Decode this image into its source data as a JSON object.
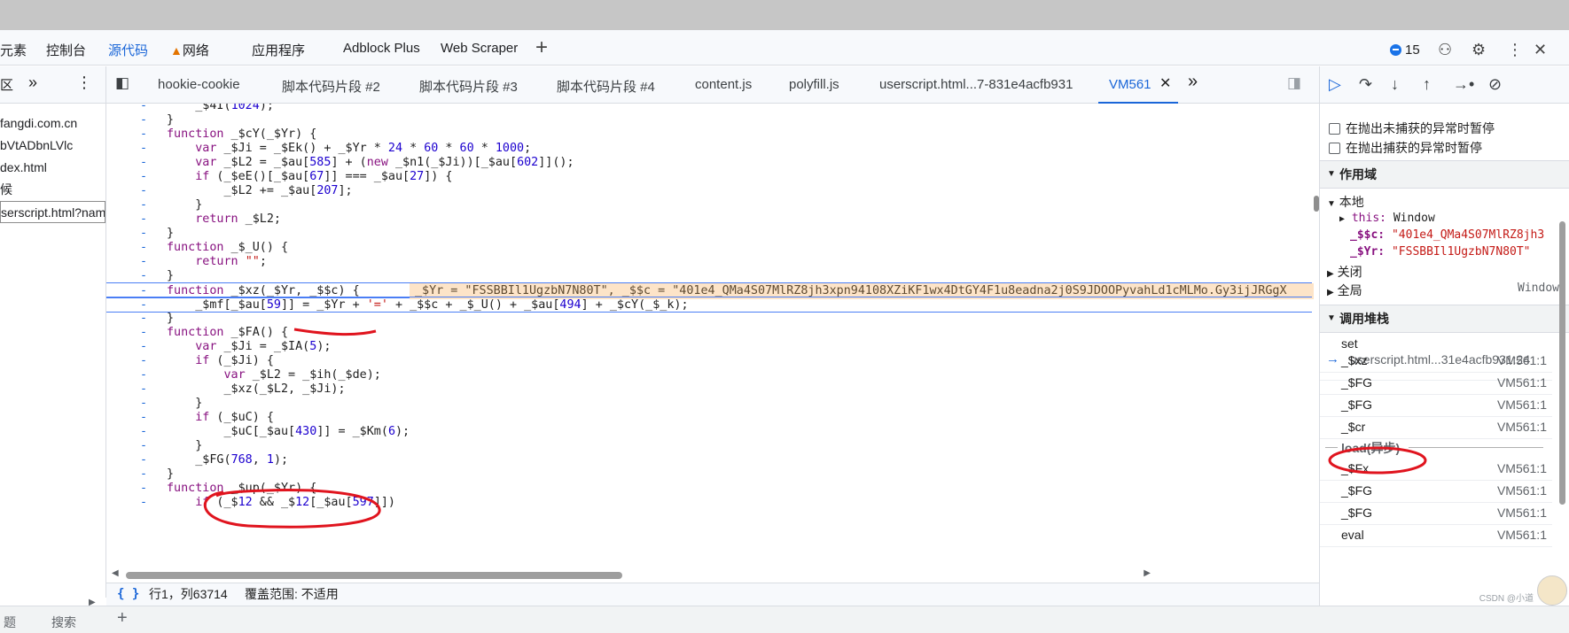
{
  "main_tabs": [
    "元素",
    "控制台",
    "源代码",
    "网络",
    "应用程序",
    "Adblock Plus",
    "Web Scraper"
  ],
  "active_main_tab": "源代码",
  "issues_count": "15",
  "navigator": {
    "items": [
      "fangdi.com.cn",
      "bVtADbnLVlc",
      "dex.html",
      "候",
      "serscript.html?name"
    ]
  },
  "source_tabs": [
    "hookie-cookie",
    "脚本代码片段 #2",
    "脚本代码片段 #3",
    "脚本代码片段 #4",
    "content.js",
    "polyfill.js",
    "userscript.html...7-831e4acfb931",
    "VM561"
  ],
  "active_source_tab": "VM561",
  "code_lines": [
    "    _$4I(1024);",
    "}",
    "function _$cY(_$Yr) {",
    "    var _$Ji = _$Ek() + _$Yr * 24 * 60 * 60 * 1000;",
    "    var _$L2 = _$au[585] + (new _$n1(_$Ji))[_$au[602]]();",
    "    if (_$eE()[_$au[67]] === _$au[27]) {",
    "        _$L2 += _$au[207];",
    "    }",
    "    return _$L2;",
    "}",
    "function _$_U() {",
    "    return \"\";",
    "}",
    "function _$xz(_$Yr, _$$c) {",
    "    _$mf[_$au[59]] = _$Yr + '=' + _$$c + _$_U() + _$au[494] + _$cY(_$_k);",
    "}",
    "function _$FA() {",
    "    var _$Ji = _$IA(5);",
    "    if (_$Ji) {",
    "        var _$L2 = _$ih(_$de);",
    "        _$xz(_$L2, _$Ji);",
    "    }",
    "    if (_$uC) {",
    "        _$uC[_$au[430]] = _$Km(6);",
    "    }",
    "    _$FG(768, 1);",
    "}",
    "function _$up(_$Yr) {",
    "    if (_$12 && _$12[_$au[597]])"
  ],
  "gutter_marker": "-",
  "inline_values": "_$Yr = \"FSSBBIl1UgzbN7N80T\", _$$c = \"401e4_QMa4S07MlRZ8jh3xpn94108XZiKF1wx4DtGY4F1u8eadna2j0S9JDOOPyvahLd1cMLMo.Gy3ijJRGgX",
  "status": {
    "position": "行1，列63714",
    "coverage": "覆盖范围: 不适用"
  },
  "drawer_tabs": [
    "题",
    "搜索",
    "+"
  ],
  "debugger": {
    "pause_uncaught": "在抛出未捕获的异常时暂停",
    "pause_caught": "在抛出捕获的异常时暂停",
    "scope_header": "作用域",
    "local_label": "本地",
    "this_key": "this:",
    "this_val": "Window",
    "var1_key": "_$$c:",
    "var1_val": "\"401e4_QMa4S07MlRZ8jh3",
    "var2_key": "_$Yr:",
    "var2_val": "\"FSSBBIl1UgzbN7N80T\"",
    "closure_label": "关闭",
    "global_label": "全局",
    "global_val": "Window",
    "callstack_header": "调用堆栈",
    "set_label": "set",
    "set_loc": "userscript.html...31e4acfb931:24",
    "frames_before": [
      {
        "name": "_$xz",
        "loc": "VM561:1",
        "current": true
      },
      {
        "name": "_$FG",
        "loc": "VM561:1",
        "current": false
      },
      {
        "name": "_$FG",
        "loc": "VM561:1",
        "current": false
      },
      {
        "name": "_$cr",
        "loc": "VM561:1",
        "current": false
      }
    ],
    "async_label": "load(异步)",
    "frames_after": [
      {
        "name": "_$Fx",
        "loc": "VM561:1"
      },
      {
        "name": "_$FG",
        "loc": "VM561:1"
      },
      {
        "name": "_$FG",
        "loc": "VM561:1"
      },
      {
        "name": "eval",
        "loc": "VM561:1"
      }
    ],
    "watermark": "CSDN @小道"
  },
  "colors": {
    "accent": "#1a66d8",
    "annotation_red": "#e0141e",
    "inline_value_bg": "#fde4c8"
  }
}
